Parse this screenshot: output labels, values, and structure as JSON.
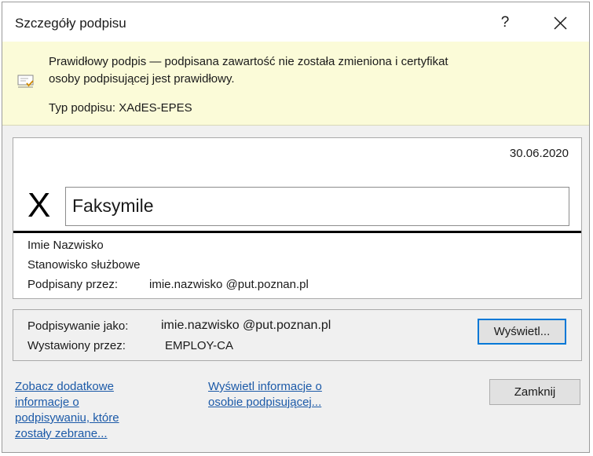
{
  "window": {
    "title": "Szczegóły podpisu",
    "help_label": "?"
  },
  "banner": {
    "message_line1": "Prawidłowy podpis — podpisana zawartość nie została zmieniona i certyfikat",
    "message_line2": "osoby podpisującej jest prawidłowy.",
    "signature_type": "Typ podpisu: XAdES-EPES"
  },
  "signature": {
    "date": "30.06.2020",
    "x_mark": "X",
    "facsimile": "Faksymile",
    "name": "Imie Nazwisko",
    "position": "Stanowisko służbowe",
    "signed_by_label": "Podpisany przez:",
    "signed_by_value": "imie.nazwisko @put.poznan.pl"
  },
  "certificate": {
    "signing_as_label": "Podpisywanie jako:",
    "signing_as_value": "imie.nazwisko @put.poznan.pl",
    "issued_by_label": "Wystawiony przez:",
    "issued_by_value": "EMPLOY-CA",
    "view_button": "Wyświetl..."
  },
  "links": {
    "additional_info": [
      "Zobacz dodatkowe",
      "informacje o",
      "podpisywaniu, które",
      "zostały zebrane..."
    ],
    "signer_info": [
      "Wyświetl informacje o",
      "osobie podpisującej..."
    ]
  },
  "buttons": {
    "close": "Zamknij"
  },
  "colors": {
    "banner_bg": "#fbfbd8",
    "link": "#1c5aa8",
    "focus_border": "#0078d7"
  }
}
